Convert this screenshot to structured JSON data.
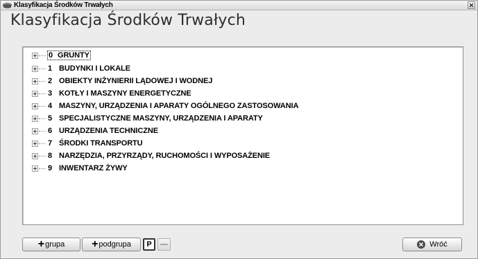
{
  "window": {
    "title": "Klasyfikacja Środków Trwałych"
  },
  "header": {
    "title": "Klasyfikacja Środków Trwałych"
  },
  "tree": {
    "items": [
      {
        "code": "0",
        "label": "GRUNTY",
        "selected": true
      },
      {
        "code": "1",
        "label": "BUDYNKI I LOKALE"
      },
      {
        "code": "2",
        "label": "OBIEKTY INŻYNIERII LĄDOWEJ I WODNEJ"
      },
      {
        "code": "3",
        "label": "KOTŁY I MASZYNY ENERGETYCZNE"
      },
      {
        "code": "4",
        "label": "MASZYNY, URZĄDZENIA I APARATY OGÓLNEGO ZASTOSOWANIA"
      },
      {
        "code": "5",
        "label": "SPECJALISTYCZNE MASZYNY, URZĄDZENIA I APARATY"
      },
      {
        "code": "6",
        "label": "URZĄDZENIA TECHNICZNE"
      },
      {
        "code": "7",
        "label": "ŚRODKI TRANSPORTU"
      },
      {
        "code": "8",
        "label": "NARZĘDZIA, PRZYRZĄDY, RUCHOMOŚCI I WYPOSAŻENIE"
      },
      {
        "code": "9",
        "label": "INWENTARZ ŻYWY"
      }
    ]
  },
  "toolbar": {
    "add_group_label": "grupa",
    "add_subgroup_label": "podgrupa",
    "p_label": "P",
    "back_label": "Wróć"
  }
}
